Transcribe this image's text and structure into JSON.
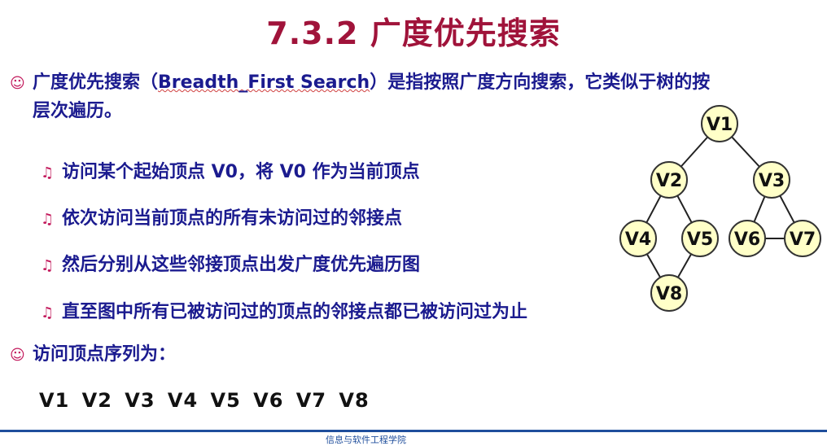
{
  "title": "7.3.2 广度优先搜索",
  "intro": {
    "bullet_icon": "smiley-icon",
    "before": "广度优先搜索（",
    "term": "Breadth_First Search",
    "after": "）是指按照广度方向搜索，它类似于树的按",
    "cont": "层次遍历。"
  },
  "steps": [
    "访问某个起始顶点 V0，将 V0 作为当前顶点",
    "依次访问当前顶点的所有未访问过的邻接点",
    "然后分别从这些邻接顶点出发广度优先遍历图",
    "直至图中所有已被访问过的顶点的邻接点都已被访问过为止"
  ],
  "step_icon": "music-note-icon",
  "sequence_label": "访问顶点序列为：",
  "sequence": "V1  V2  V3  V4  V5  V6  V7  V8",
  "footer": "信息与软件工程学院",
  "colors": {
    "title": "#a0133a",
    "text": "#1b1b8f",
    "bullet": "#c2185b",
    "node_fill": "#ffffc8",
    "node_stroke": "#333333"
  },
  "graph": {
    "nodes": [
      "V1",
      "V2",
      "V3",
      "V4",
      "V5",
      "V6",
      "V7",
      "V8"
    ],
    "edges": [
      [
        "V1",
        "V2"
      ],
      [
        "V1",
        "V3"
      ],
      [
        "V2",
        "V4"
      ],
      [
        "V2",
        "V5"
      ],
      [
        "V3",
        "V6"
      ],
      [
        "V3",
        "V7"
      ],
      [
        "V6",
        "V7"
      ],
      [
        "V4",
        "V8"
      ],
      [
        "V5",
        "V8"
      ]
    ]
  }
}
